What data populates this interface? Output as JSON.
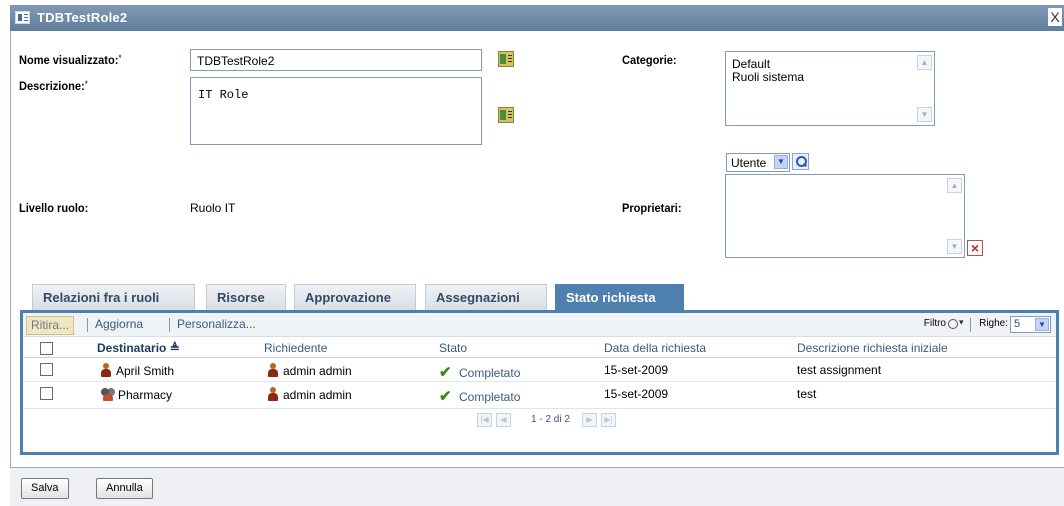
{
  "window": {
    "title": "TDBTestRole2",
    "close_glyph": "X"
  },
  "form": {
    "display_name_label": "Nome visualizzato:",
    "display_name_value": "TDBTestRole2",
    "description_label": "Descrizione:",
    "description_value": "IT Role",
    "required_mark": "*",
    "categories_label": "Categorie:",
    "categories": [
      "Default",
      "Ruoli sistema"
    ],
    "role_level_label": "Livello ruolo:",
    "role_level_value": "Ruolo IT",
    "owners_label": "Proprietari:",
    "owner_type_selected": "Utente"
  },
  "tabs": [
    {
      "label": "Relazioni fra i ruoli"
    },
    {
      "label": "Risorse"
    },
    {
      "label": "Approvazione"
    },
    {
      "label": "Assegnazioni"
    },
    {
      "label": "Stato richiesta"
    }
  ],
  "toolbar": {
    "ritira": "Ritira...",
    "aggiorna": "Aggiorna",
    "personalizza": "Personalizza...",
    "filtro": "Filtro",
    "righe_label": "Righe:",
    "righe_value": "5"
  },
  "table": {
    "columns": [
      "Destinatario",
      "Richiedente",
      "Stato",
      "Data della richiesta",
      "Descrizione richiesta iniziale"
    ],
    "sort_glyph": "≜",
    "rows": [
      {
        "recipient": "April Smith",
        "recipient_icon": "user-icon",
        "requester": "admin admin",
        "status": "Completato",
        "date": "15-set-2009",
        "description": "test assignment"
      },
      {
        "recipient": "Pharmacy",
        "recipient_icon": "group-icon",
        "requester": "admin admin",
        "status": "Completato",
        "date": "15-set-2009",
        "description": "test"
      }
    ]
  },
  "pager": {
    "info": "1 - 2 di 2"
  },
  "buttons": {
    "save": "Salva",
    "cancel": "Annulla"
  },
  "colors": {
    "titlebar": "#6987a6",
    "accent": "#4f7faf",
    "link": "#3a5a82"
  }
}
